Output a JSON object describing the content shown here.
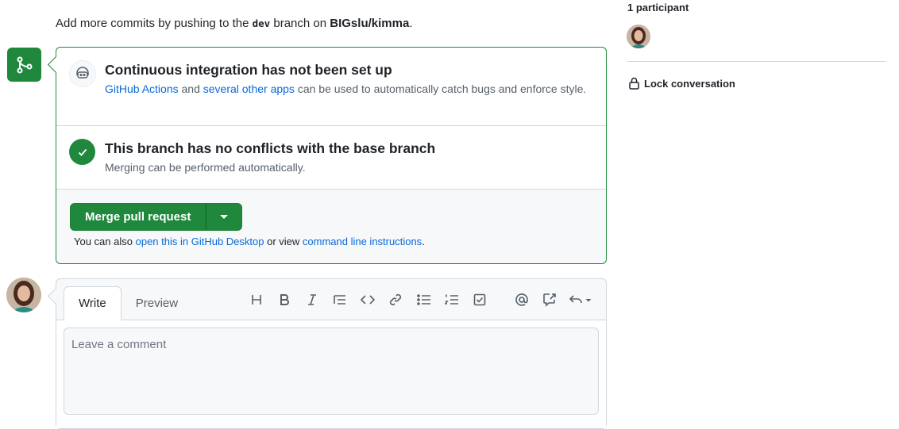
{
  "push_hint": {
    "prefix": "Add more commits by pushing to the",
    "branch": "dev",
    "middle": "branch on",
    "repo": "BIGslu/kimma",
    "suffix": "."
  },
  "ci": {
    "title": "Continuous integration has not been set up",
    "link1": "GitHub Actions",
    "and": " and ",
    "link2": "several other apps",
    "rest": " can be used to automatically catch bugs and enforce style."
  },
  "conflicts": {
    "title": "This branch has no conflicts with the base branch",
    "body": "Merging can be performed automatically."
  },
  "merge": {
    "button_label": "Merge pull request",
    "also_prefix": "You can also",
    "desktop_link": "open this in GitHub Desktop",
    "or_view": " or view ",
    "cli_link": "command line instructions",
    "period": "."
  },
  "sidebar": {
    "participants": "1 participant",
    "lock_label": "Lock conversation"
  },
  "comment": {
    "tabs": [
      "Write",
      "Preview"
    ],
    "placeholder": "Leave a comment",
    "toolbar_icons": [
      "heading-icon",
      "bold-icon",
      "italic-icon",
      "quote-icon",
      "code-icon",
      "link-icon",
      "unordered-list-icon",
      "ordered-list-icon",
      "task-list-icon",
      "mention-icon",
      "reference-icon",
      "reply-icon"
    ]
  },
  "colors": {
    "success": "#1f883d",
    "link": "#0969da",
    "border": "#d0d7de"
  }
}
